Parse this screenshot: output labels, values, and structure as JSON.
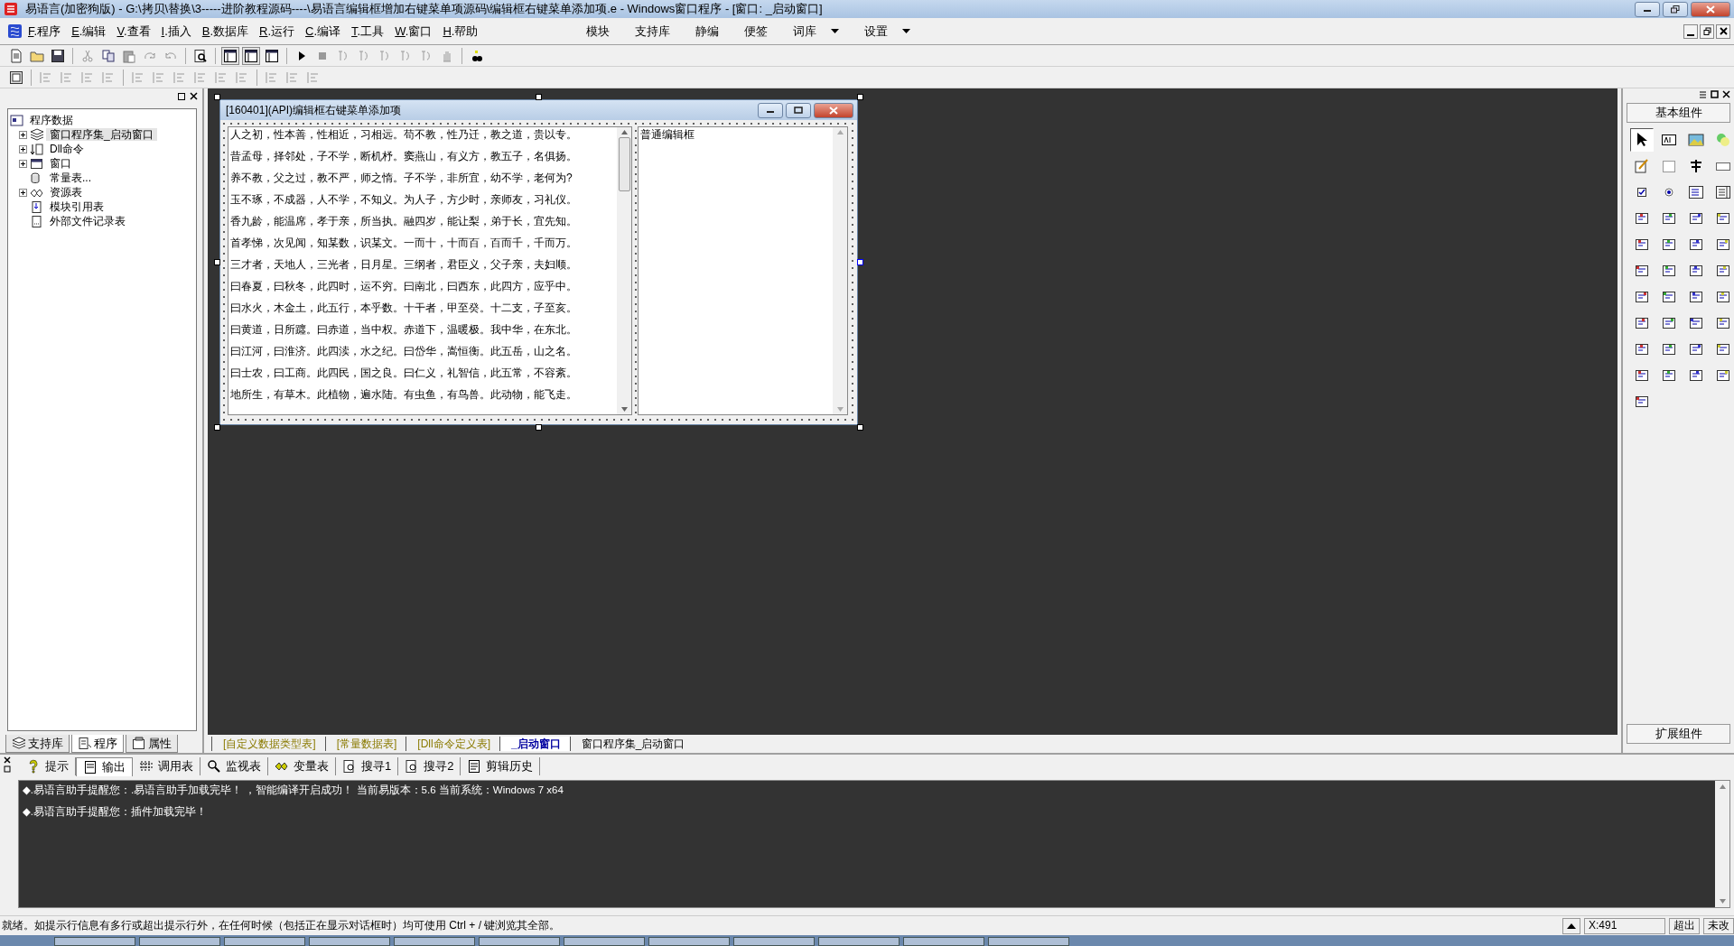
{
  "window": {
    "title": "易语言(加密狗版) - G:\\拷贝\\替换\\3-----进阶教程源码----\\易语言编辑框增加右键菜单项源码\\编辑框右键菜单添加项.e - Windows窗口程序 - [窗口: _启动窗口]"
  },
  "menu": [
    {
      "label": "F.程序"
    },
    {
      "label": "E.编辑"
    },
    {
      "label": "V.查看"
    },
    {
      "label": "I.插入"
    },
    {
      "label": "B.数据库"
    },
    {
      "label": "R.运行"
    },
    {
      "label": "C.编译"
    },
    {
      "label": "T.工具"
    },
    {
      "label": "W.窗口"
    },
    {
      "label": "H.帮助"
    }
  ],
  "menu_right": [
    {
      "label": "模块",
      "dropdown": false
    },
    {
      "label": "支持库",
      "dropdown": false
    },
    {
      "label": "静编",
      "dropdown": false
    },
    {
      "label": "便签",
      "dropdown": false
    },
    {
      "label": "词库",
      "dropdown": true
    },
    {
      "label": "设置",
      "dropdown": true
    }
  ],
  "tree": [
    {
      "label": "程序数据",
      "selected": false,
      "children": [
        {
          "label": "窗口程序集_启动窗口",
          "kind": "group",
          "expanded": false,
          "selected": true
        },
        {
          "label": "Dll命令",
          "kind": "group",
          "expanded": false,
          "selected": false
        },
        {
          "label": "窗口",
          "kind": "group",
          "expanded": false,
          "selected": false
        },
        {
          "label": "常量表...",
          "kind": "leaf",
          "selected": false
        },
        {
          "label": "资源表",
          "kind": "group",
          "expanded": false,
          "selected": false
        },
        {
          "label": "模块引用表",
          "kind": "leaf",
          "selected": false
        },
        {
          "label": "外部文件记录表",
          "kind": "leaf",
          "selected": false
        }
      ]
    }
  ],
  "left_tabs": [
    {
      "label": "支持库",
      "selected": false
    },
    {
      "label": "程序",
      "selected": true
    },
    {
      "label": "属性",
      "selected": false
    }
  ],
  "form": {
    "title": "[160401](API)编辑框右键菜单添加项",
    "edit_left": {
      "lines": [
        "人之初，性本善，性相近，习相远。苟不教，性乃迁，教之道，贵以专。",
        "昔孟母，择邻处，子不学，断机杼。窦燕山，有义方，教五子，名俱扬。",
        "养不教，父之过，教不严，师之惰。子不学，非所宜，幼不学，老何为?",
        "玉不琢，不成器，人不学，不知义。为人子，方少时，亲师友，习礼仪。",
        "香九龄，能温席，孝于亲，所当执。融四岁，能让梨，弟于长，宜先知。",
        "首孝悌，次见闻，知某数，识某文。一而十，十而百，百而千，千而万。",
        "三才者，天地人，三光者，日月星。三纲者，君臣义，父子亲，夫妇顺。",
        "曰春夏，曰秋冬，此四时，运不穷。曰南北，曰西东，此四方，应乎中。",
        "曰水火，木金土，此五行，本乎数。十干者，甲至癸。十二支，子至亥。",
        "曰黄道，日所躔。曰赤道，当中权。赤道下，温暖极。我中华，在东北。",
        "曰江河，曰淮济。此四渎，水之纪。曰岱华，嵩恒衡。此五岳，山之名。",
        "曰士农，曰工商。此四民，国之良。曰仁义，礼智信，此五常，不容紊。",
        "地所生，有草木。此植物，遍水陆。有虫鱼，有鸟兽。此动物，能飞走。"
      ]
    },
    "edit_right": {
      "text": "普通编辑框"
    }
  },
  "doc_tabs": [
    {
      "label": "[自定义数据类型表]",
      "kind": "table",
      "selected": false
    },
    {
      "label": "[常量数据表]",
      "kind": "table",
      "selected": false
    },
    {
      "label": "[Dll命令定义表]",
      "kind": "table",
      "selected": false
    },
    {
      "label": "_启动窗口",
      "kind": "window",
      "selected": true
    },
    {
      "label": "窗口程序集_启动窗口",
      "kind": "code",
      "selected": false
    }
  ],
  "toolbox": {
    "title": "基本组件",
    "footer": "扩展组件",
    "tools": [
      {
        "selected": true
      },
      {
        "selected": false
      },
      {
        "selected": false
      },
      {
        "selected": false
      },
      {
        "selected": false
      },
      {
        "selected": false
      },
      {
        "selected": false
      },
      {
        "selected": false
      },
      {
        "selected": false
      },
      {
        "selected": false
      },
      {
        "selected": false
      },
      {
        "selected": false
      },
      {
        "selected": false
      },
      {
        "selected": false
      },
      {
        "selected": false
      },
      {
        "selected": false
      },
      {
        "selected": false
      },
      {
        "selected": false
      },
      {
        "selected": false
      },
      {
        "selected": false
      },
      {
        "selected": false
      },
      {
        "selected": false
      },
      {
        "selected": false
      },
      {
        "selected": false
      },
      {
        "selected": false
      },
      {
        "selected": false
      },
      {
        "selected": false
      },
      {
        "selected": false
      },
      {
        "selected": false
      },
      {
        "selected": false
      },
      {
        "selected": false
      },
      {
        "selected": false
      },
      {
        "selected": false
      },
      {
        "selected": false
      },
      {
        "selected": false
      },
      {
        "selected": false
      },
      {
        "selected": false
      },
      {
        "selected": false
      },
      {
        "selected": false
      },
      {
        "selected": false
      },
      {
        "selected": false
      }
    ]
  },
  "output_tabs": [
    {
      "label": "提示",
      "selected": false
    },
    {
      "label": "输出",
      "selected": true
    },
    {
      "label": "调用表",
      "selected": false
    },
    {
      "label": "监视表",
      "selected": false
    },
    {
      "label": "变量表",
      "selected": false
    },
    {
      "label": "搜寻1",
      "selected": false
    },
    {
      "label": "搜寻2",
      "selected": false
    },
    {
      "label": "剪辑历史",
      "selected": false
    }
  ],
  "output_lines": [
    "◆.易语言助手提醒您：.易语言助手加载完毕！ ，智能编译开启成功！ 当前易版本：5.6  当前系统：Windows 7 x64",
    "◆.易语言助手提醒您：插件加载完毕！"
  ],
  "status": {
    "text": "就绪。如提示行信息有多行或超出提示行外，在任何时候（包括正在显示对话框时）均可使用 Ctrl + / 键浏览其全部。",
    "position": "X:491",
    "mode": "超出",
    "modified": "未改"
  }
}
